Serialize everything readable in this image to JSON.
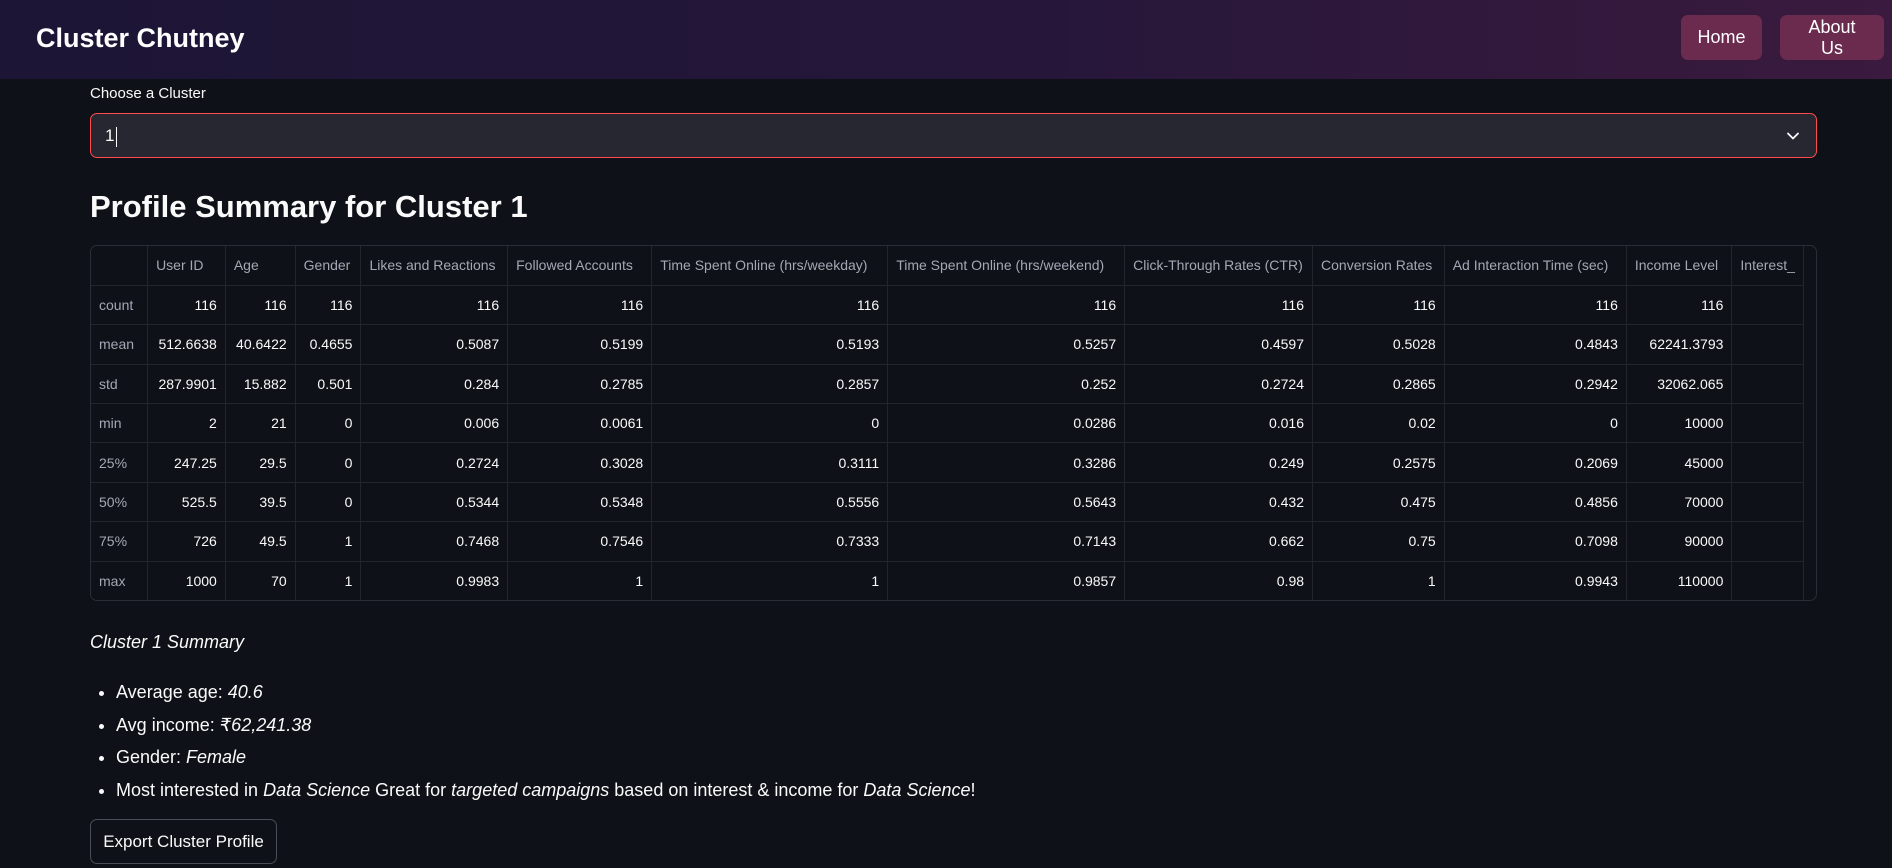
{
  "header": {
    "title": "Cluster Chutney",
    "nav": [
      {
        "label": "Home"
      },
      {
        "label": "About Us"
      }
    ]
  },
  "select": {
    "label": "Choose a Cluster",
    "value": "1"
  },
  "section": {
    "title": "Profile Summary for Cluster 1"
  },
  "table": {
    "columns": [
      "",
      "User ID",
      "Age",
      "Gender",
      "Likes and Reactions",
      "Followed Accounts",
      "Time Spent Online (hrs/weekday)",
      "Time Spent Online (hrs/weekend)",
      "Click-Through Rates (CTR)",
      "Conversion Rates",
      "Ad Interaction Time (sec)",
      "Income Level",
      "Interest_"
    ],
    "rows": [
      {
        "label": "count",
        "cells": [
          "116",
          "116",
          "116",
          "116",
          "116",
          "116",
          "116",
          "116",
          "116",
          "116",
          "116",
          ""
        ]
      },
      {
        "label": "mean",
        "cells": [
          "512.6638",
          "40.6422",
          "0.4655",
          "0.5087",
          "0.5199",
          "0.5193",
          "0.5257",
          "0.4597",
          "0.5028",
          "0.4843",
          "62241.3793",
          ""
        ]
      },
      {
        "label": "std",
        "cells": [
          "287.9901",
          "15.882",
          "0.501",
          "0.284",
          "0.2785",
          "0.2857",
          "0.252",
          "0.2724",
          "0.2865",
          "0.2942",
          "32062.065",
          ""
        ]
      },
      {
        "label": "min",
        "cells": [
          "2",
          "21",
          "0",
          "0.006",
          "0.0061",
          "0",
          "0.0286",
          "0.016",
          "0.02",
          "0",
          "10000",
          ""
        ]
      },
      {
        "label": "25%",
        "cells": [
          "247.25",
          "29.5",
          "0",
          "0.2724",
          "0.3028",
          "0.3111",
          "0.3286",
          "0.249",
          "0.2575",
          "0.2069",
          "45000",
          ""
        ]
      },
      {
        "label": "50%",
        "cells": [
          "525.5",
          "39.5",
          "0",
          "0.5344",
          "0.5348",
          "0.5556",
          "0.5643",
          "0.432",
          "0.475",
          "0.4856",
          "70000",
          ""
        ]
      },
      {
        "label": "75%",
        "cells": [
          "726",
          "49.5",
          "1",
          "0.7468",
          "0.7546",
          "0.7333",
          "0.7143",
          "0.662",
          "0.75",
          "0.7098",
          "90000",
          ""
        ]
      },
      {
        "label": "max",
        "cells": [
          "1000",
          "70",
          "1",
          "0.9983",
          "1",
          "1",
          "0.9857",
          "0.98",
          "1",
          "0.9943",
          "110000",
          ""
        ]
      }
    ]
  },
  "summary": {
    "title": "Cluster 1 Summary",
    "age_label": "Average age: ",
    "age_value": "40.6",
    "income_label": "Avg income: ",
    "income_value": "₹62,241.38",
    "gender_label": "Gender: ",
    "gender_value": "Female",
    "interest_pre": "Most interested in ",
    "interest_value": "Data Science",
    "interest_mid1": " Great for ",
    "interest_campaign": "targeted campaigns",
    "interest_mid2": " based on interest & income for ",
    "interest_value2": "Data Science",
    "interest_end": "!"
  },
  "export_button": "Export Cluster Profile",
  "colors": {
    "background": "#0e1117",
    "header": "#26173a",
    "nav_button": "#6b2b4f",
    "select_border": "#ff4b4b"
  }
}
